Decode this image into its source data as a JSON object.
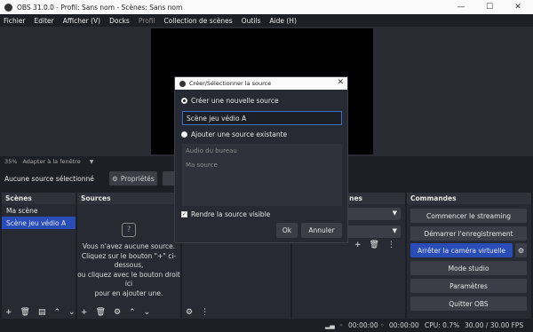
{
  "window": {
    "title": "OBS 31.0.0 - Profil: Sans nom - Scènes: Sans nom",
    "minimize": "—",
    "maximize": "☐",
    "close": "✕"
  },
  "menu": [
    "Fichier",
    "Editer",
    "Afficher (V)",
    "Docks",
    "Profil",
    "Collection de scènes",
    "Outils",
    "Aide (H)"
  ],
  "zoom": {
    "value": "35%",
    "fit": "Adapter à la fenêtre"
  },
  "source_bar": {
    "label": "Aucune source sélectionné",
    "properties": "Propriétés"
  },
  "scenes": {
    "title": "Scènes",
    "items": [
      "Ma scène",
      "Scène jeu védio A"
    ],
    "selected": 1
  },
  "sources": {
    "title": "Sources",
    "empty_lines": [
      "Vous n'avez aucune source.",
      "Cliquez sur le bouton \"+\" ci-dessous,",
      "ou cliquez avec le bouton droit ici",
      "pour en ajouter une."
    ]
  },
  "audio_mixer": {
    "title_fragment": "nes"
  },
  "commands": {
    "title": "Commandes",
    "buttons": [
      "Commencer le streaming",
      "Démarrer l'enregistrement",
      "Arrêter la caméra virtuelle",
      "Mode studio",
      "Paramètres",
      "Quitter OBS"
    ]
  },
  "status": {
    "stream_time": "00:00:00",
    "rec_time": "00:00:00",
    "cpu": "CPU: 0.7%",
    "fps": "30.00 / 30.00 FPS"
  },
  "dialog": {
    "title": "Créer/Sélectionner la source",
    "create_new": "Créer une nouvelle source",
    "name_value": "Scène jeu védio A",
    "add_existing": "Ajouter une source existante",
    "existing": [
      "Audio du bureau",
      "Ma source"
    ],
    "visible_label": "Rendre la source visible",
    "ok": "Ok",
    "cancel": "Annuler"
  },
  "colors": {
    "accent": "#284cb8",
    "panel": "#272a33",
    "background": "#1d1f26"
  }
}
